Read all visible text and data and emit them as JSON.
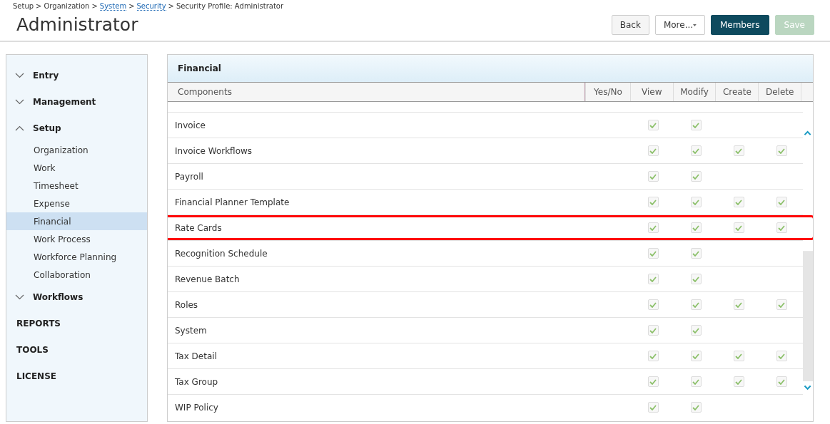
{
  "breadcrumb": [
    {
      "label": "Setup",
      "kind": "text"
    },
    {
      "label": ">",
      "kind": "separator"
    },
    {
      "label": "Organization",
      "kind": "text"
    },
    {
      "label": ">",
      "kind": "separator"
    },
    {
      "label": "System",
      "kind": "link"
    },
    {
      "label": ">",
      "kind": "separator"
    },
    {
      "label": "Security",
      "kind": "link"
    },
    {
      "label": ">",
      "kind": "separator"
    },
    {
      "label": "Security Profile: Administrator",
      "kind": "text"
    }
  ],
  "title": "Administrator",
  "buttons": [
    {
      "label": "Back",
      "kind": "default",
      "disabled": false
    },
    {
      "label": "More...",
      "kind": "dropdown",
      "disabled": false
    },
    {
      "label": "Members",
      "kind": "primary",
      "disabled": false
    },
    {
      "label": "Save",
      "kind": "primary",
      "disabled": true
    }
  ],
  "sidebar": {
    "items": [
      {
        "label": "Entry",
        "kind": "group",
        "expanded": false
      },
      {
        "label": "Management",
        "kind": "group",
        "expanded": false
      },
      {
        "label": "Setup",
        "kind": "group",
        "expanded": true,
        "children": [
          {
            "label": "Organization",
            "selected": false
          },
          {
            "label": "Work",
            "selected": false
          },
          {
            "label": "Timesheet",
            "selected": false
          },
          {
            "label": "Expense",
            "selected": false
          },
          {
            "label": "Financial",
            "selected": true
          },
          {
            "label": "Work Process",
            "selected": false
          },
          {
            "label": "Workforce Planning",
            "selected": false
          },
          {
            "label": "Collaboration",
            "selected": false
          }
        ]
      },
      {
        "label": "Workflows",
        "kind": "group",
        "expanded": false
      },
      {
        "label": "REPORTS",
        "kind": "section"
      },
      {
        "label": "TOOLS",
        "kind": "section"
      },
      {
        "label": "LICENSE",
        "kind": "section"
      }
    ]
  },
  "panel": {
    "title": "Financial",
    "table": {
      "columns": [
        "Components",
        "Yes/No",
        "View",
        "Modify",
        "Create",
        "Delete"
      ],
      "rows": [
        {
          "name": "Invoice",
          "highlighted": false,
          "view": true,
          "modify": true
        },
        {
          "name": "Invoice Workflows",
          "highlighted": false,
          "view": true,
          "modify": true,
          "create": true,
          "delete": true
        },
        {
          "name": "Payroll",
          "highlighted": false,
          "view": true,
          "modify": true
        },
        {
          "name": "Financial Planner Template",
          "highlighted": false,
          "view": true,
          "modify": true,
          "create": true,
          "delete": true
        },
        {
          "name": "Rate Cards",
          "highlighted": true,
          "view": true,
          "modify": true,
          "create": true,
          "delete": true
        },
        {
          "name": "Recognition Schedule",
          "highlighted": false,
          "view": true,
          "modify": true
        },
        {
          "name": "Revenue Batch",
          "highlighted": false,
          "view": true,
          "modify": true
        },
        {
          "name": "Roles",
          "highlighted": false,
          "view": true,
          "modify": true,
          "create": true,
          "delete": true
        },
        {
          "name": "System",
          "highlighted": false,
          "view": true,
          "modify": true
        },
        {
          "name": "Tax Detail",
          "highlighted": false,
          "view": true,
          "modify": true,
          "create": true,
          "delete": true
        },
        {
          "name": "Tax Group",
          "highlighted": false,
          "view": true,
          "modify": true,
          "create": true,
          "delete": true
        },
        {
          "name": "WIP Policy",
          "highlighted": false,
          "view": true,
          "modify": true
        }
      ]
    }
  }
}
